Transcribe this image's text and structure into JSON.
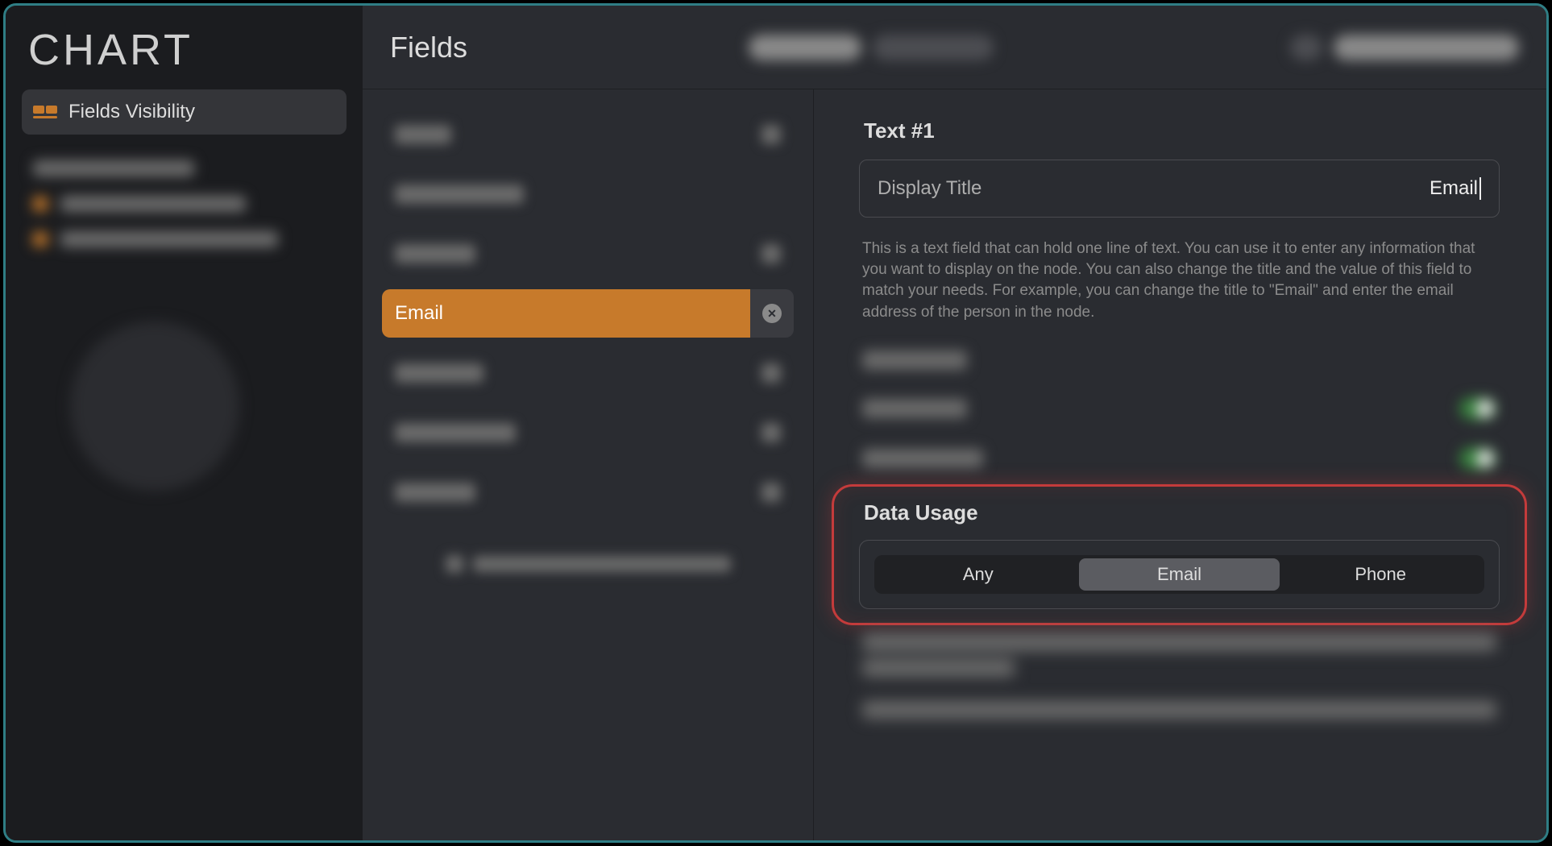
{
  "app": {
    "title": "CHART"
  },
  "sidebar": {
    "items": [
      {
        "label": "Fields Visibility"
      }
    ]
  },
  "topbar": {
    "title": "Fields"
  },
  "fields": {
    "selected": {
      "label": "Email"
    }
  },
  "detail": {
    "title": "Text #1",
    "display_title_label": "Display Title",
    "display_title_value": "Email",
    "description": "This is a text field that can hold one line of text. You can use it to enter any information that you want to display on the node. You can also change the title and the value of this field to match your needs. For example, you can change the title to \"Email\" and enter the email address of the person in the node.",
    "data_usage": {
      "title": "Data Usage",
      "options": [
        "Any",
        "Email",
        "Phone"
      ],
      "selected": "Email"
    }
  }
}
